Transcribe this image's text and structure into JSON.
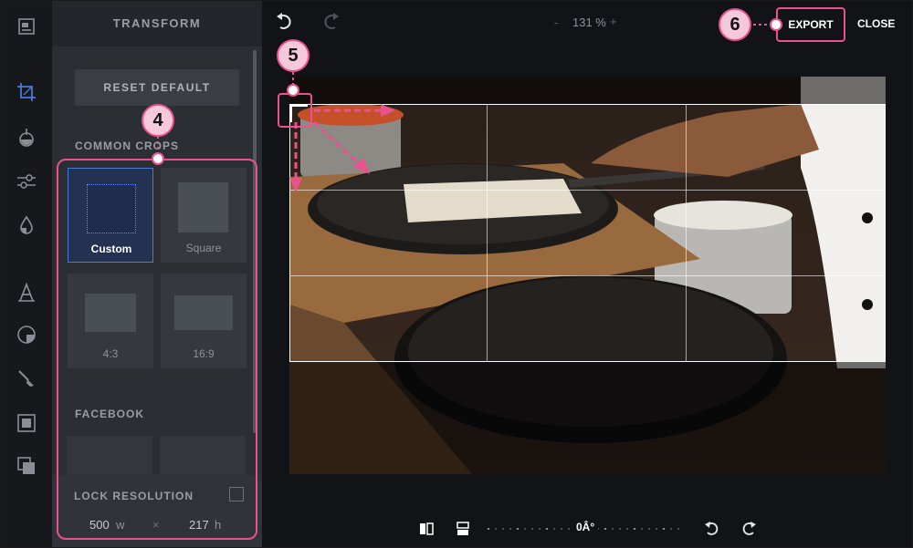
{
  "panel": {
    "title": "TRANSFORM",
    "reset_label": "RESET DEFAULT",
    "common_crops_title": "COMMON CROPS",
    "crops": [
      {
        "label": "Custom",
        "selected": true
      },
      {
        "label": "Square",
        "selected": false
      },
      {
        "label": "4:3",
        "selected": false
      },
      {
        "label": "16:9",
        "selected": false
      }
    ],
    "facebook_title": "FACEBOOK",
    "lock_resolution_label": "LOCK RESOLUTION",
    "lock_resolution_checked": false,
    "resolution": {
      "width": "500",
      "width_unit": "w",
      "separator": "×",
      "height": "217",
      "height_unit": "h"
    }
  },
  "rail": {
    "icons": [
      "adjust-icon",
      "crop-icon",
      "filter-icon",
      "sliders-icon",
      "drop-icon",
      "text-icon",
      "sticker-icon",
      "brush-icon",
      "frame-icon",
      "overlay-icon"
    ],
    "active": "crop-icon"
  },
  "toolbar": {
    "zoom_minus": "-",
    "zoom_value": "131 %",
    "zoom_plus": "+",
    "export_label": "EXPORT",
    "close_label": "CLOSE"
  },
  "bottom": {
    "angle_value": "0Â°"
  },
  "callouts": {
    "crops": "4",
    "handle": "5",
    "export": "6"
  },
  "colors": {
    "accent": "#e9528e",
    "selected": "#4a7ad8",
    "panel": "#2b2e33"
  }
}
